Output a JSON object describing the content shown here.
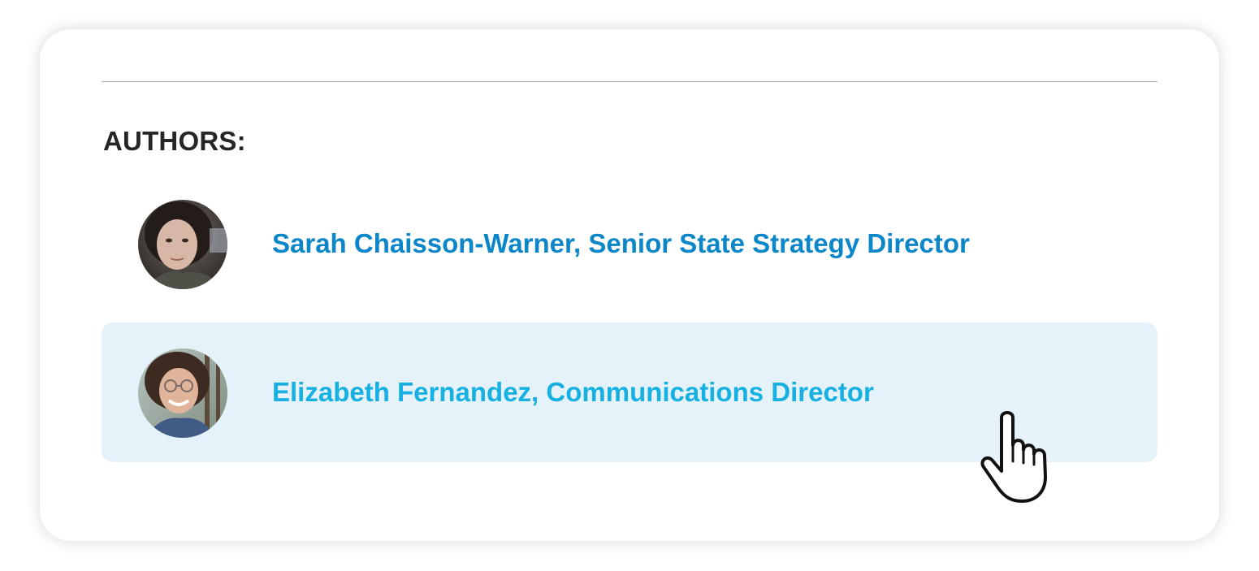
{
  "section": {
    "heading": "AUTHORS:"
  },
  "authors": [
    {
      "name": "Sarah Chaisson-Warner, Senior State Strategy Director",
      "link_color": "#0a86c9",
      "hovered": false
    },
    {
      "name": "Elizabeth Fernandez, Communications Director",
      "link_color": "#16b1e2",
      "hovered": true
    }
  ],
  "colors": {
    "heading": "#262626",
    "hover_background": "#e5f2f9",
    "divider": "#a7a7a7"
  },
  "icons": {
    "cursor": "pointer-hand-icon"
  }
}
